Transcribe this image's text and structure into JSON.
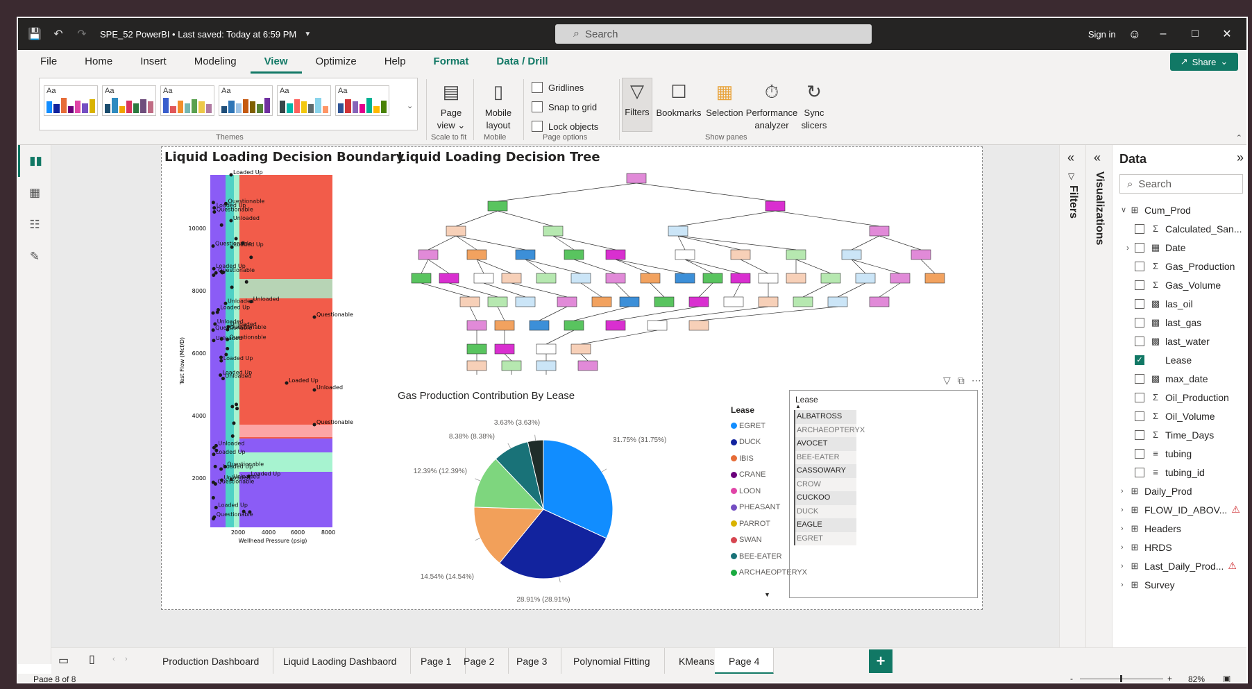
{
  "window": {
    "title": "SPE_52 PowerBI • Last saved: Today at 6:59 PM",
    "search_placeholder": "Search",
    "sign_in": "Sign in"
  },
  "menu": {
    "items": [
      "File",
      "Home",
      "Insert",
      "Modeling",
      "View",
      "Optimize",
      "Help",
      "Format",
      "Data / Drill"
    ],
    "active": "View",
    "share": "Share"
  },
  "ribbon": {
    "themes_label": "Themes",
    "theme_tile_text": "Aa",
    "page_view": "Page view",
    "page_view_arrow": "⌄",
    "scale_to_fit": "Scale to fit",
    "mobile_layout": "Mobile layout",
    "mobile": "Mobile",
    "gridlines": "Gridlines",
    "snap_to_grid": "Snap to grid",
    "lock_objects": "Lock objects",
    "page_options": "Page options",
    "filters": "Filters",
    "bookmarks": "Bookmarks",
    "selection": "Selection",
    "performance_analyzer": "Performance analyzer",
    "sync_slicers": "Sync slicers",
    "show_panes": "Show panes"
  },
  "visuals": {
    "decision_boundary_title": "Liquid Loading Decision Boundary",
    "decision_tree_title": "Liquid Loading Decision Tree",
    "pie_title": "Gas Production Contribution By Lease"
  },
  "decision_boundary": {
    "ylabel": "Test Flow (Mcf/D)",
    "xlabel": "Wellhead Pressure (psig)",
    "yticks": [
      "10000",
      "8000",
      "6000",
      "4000",
      "2000"
    ],
    "xticks": [
      "2000",
      "4000",
      "6000",
      "8000"
    ],
    "point_labels": [
      "Unloaded",
      "Questionable",
      "Loaded Up"
    ]
  },
  "chart_data": {
    "type": "pie",
    "title": "Gas Production Contribution By Lease",
    "legend_title": "Lease",
    "legend": [
      "EGRET",
      "DUCK",
      "IBIS",
      "CRANE",
      "LOON",
      "PHEASANT",
      "PARROT",
      "SWAN",
      "BEE-EATER",
      "ARCHAEOPTERYX"
    ],
    "legend_colors": [
      "#118dff",
      "#12239e",
      "#e66c37",
      "#6b007b",
      "#e044a7",
      "#744ec2",
      "#d9b300",
      "#d64550",
      "#197278",
      "#1aab40"
    ],
    "slices": [
      {
        "label": "31.75% (31.75%)",
        "value": 31.75,
        "color": "#118dff"
      },
      {
        "label": "28.91% (28.91%)",
        "value": 28.91,
        "color": "#12239e"
      },
      {
        "label": "14.54% (14.54%)",
        "value": 14.54,
        "color": "#f2a05a"
      },
      {
        "label": "12.39% (12.39%)",
        "value": 12.39,
        "color": "#7ed67e"
      },
      {
        "label": "8.38% (8.38%)",
        "value": 8.38,
        "color": "#197278"
      },
      {
        "label": "3.63% (3.63%)",
        "value": 3.63,
        "color": "#1f2d2a"
      }
    ]
  },
  "slicer": {
    "title": "Lease",
    "items": [
      "ALBATROSS",
      "ARCHAEOPTERYX",
      "AVOCET",
      "BEE-EATER",
      "CASSOWARY",
      "CROW",
      "CUCKOO",
      "DUCK",
      "EAGLE",
      "EGRET"
    ]
  },
  "panes": {
    "filters": "Filters",
    "visualizations": "Visualizations",
    "data": "Data",
    "data_search": "Search"
  },
  "fields": [
    {
      "name": "Cum_Prod",
      "type": "table",
      "level": 0,
      "expanded": true
    },
    {
      "name": "Calculated_San...",
      "type": "sigma",
      "level": 1,
      "checked": false
    },
    {
      "name": "Date",
      "type": "date",
      "level": 1,
      "checked": false,
      "expandable": true
    },
    {
      "name": "Gas_Production",
      "type": "sigma",
      "level": 1,
      "checked": false
    },
    {
      "name": "Gas_Volume",
      "type": "sigma",
      "level": 1,
      "checked": false
    },
    {
      "name": "las_oil",
      "type": "calc",
      "level": 1,
      "checked": false
    },
    {
      "name": "last_gas",
      "type": "calc",
      "level": 1,
      "checked": false
    },
    {
      "name": "last_water",
      "type": "calc",
      "level": 1,
      "checked": false
    },
    {
      "name": "Lease",
      "type": "none",
      "level": 1,
      "checked": true
    },
    {
      "name": "max_date",
      "type": "calc",
      "level": 1,
      "checked": false
    },
    {
      "name": "Oil_Production",
      "type": "sigma",
      "level": 1,
      "checked": false
    },
    {
      "name": "Oil_Volume",
      "type": "sigma",
      "level": 1,
      "checked": false
    },
    {
      "name": "Time_Days",
      "type": "sigma",
      "level": 1,
      "checked": false
    },
    {
      "name": "tubing",
      "type": "hier",
      "level": 1,
      "checked": false
    },
    {
      "name": "tubing_id",
      "type": "hier",
      "level": 1,
      "checked": false
    },
    {
      "name": "Daily_Prod",
      "type": "table",
      "level": 0
    },
    {
      "name": "FLOW_ID_ABOV...",
      "type": "table",
      "level": 0,
      "warn": true
    },
    {
      "name": "Headers",
      "type": "table",
      "level": 0
    },
    {
      "name": "HRDS",
      "type": "table",
      "level": 0
    },
    {
      "name": "Last_Daily_Prod...",
      "type": "table",
      "level": 0,
      "warn": true
    },
    {
      "name": "Survey",
      "type": "table",
      "level": 0
    }
  ],
  "tabs": [
    "Production Dashboard",
    "Liquid Laoding Dashbaord",
    "Page 1",
    "Page 2",
    "Page 3",
    "Polynomial Fitting",
    "KMeans",
    "Page 4"
  ],
  "active_tab": "Page 4",
  "status": {
    "page": "Page 8 of 8",
    "zoom": "82%"
  }
}
